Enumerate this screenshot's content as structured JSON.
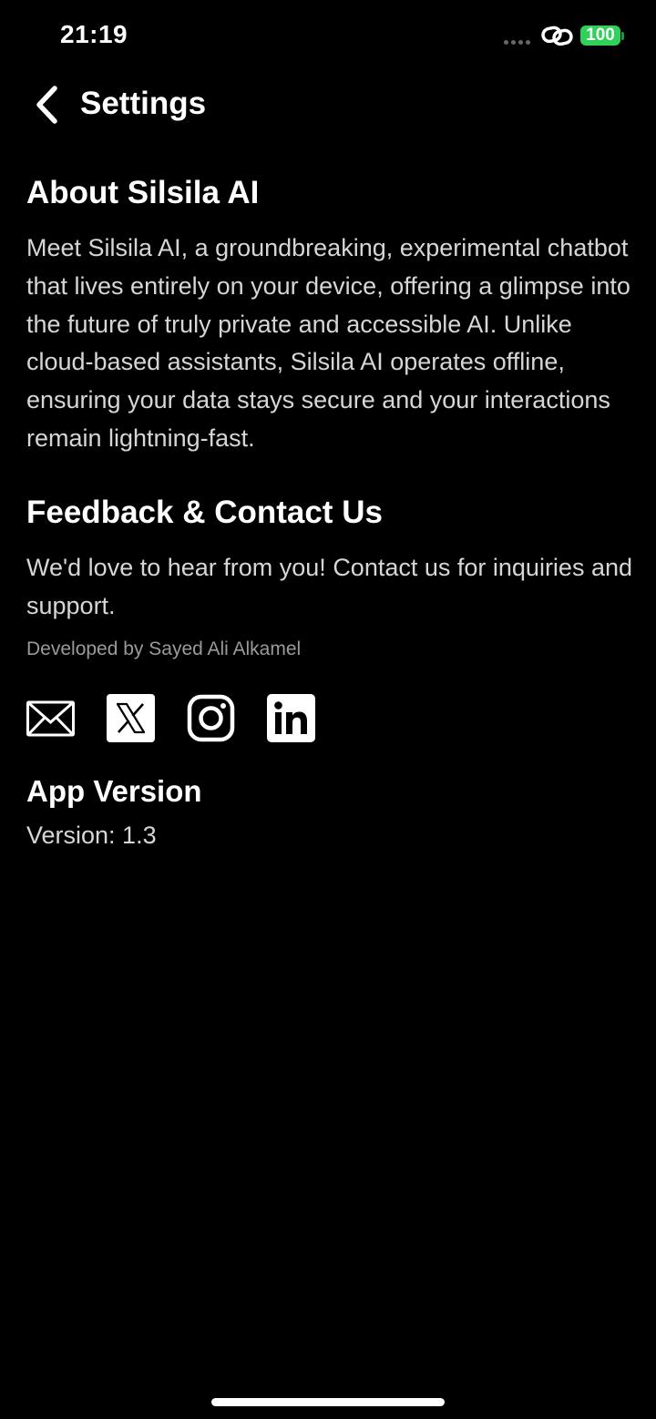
{
  "status_bar": {
    "time": "21:19",
    "battery_level": "100",
    "battery_color": "#30d158"
  },
  "header": {
    "title": "Settings",
    "back_icon": "chevron-left-icon"
  },
  "about": {
    "heading": "About Silsila AI",
    "body": "Meet Silsila AI, a groundbreaking, experimental chatbot that lives entirely on your device, offering a glimpse into the future of truly private and accessible AI. Unlike cloud-based assistants, Silsila AI operates offline, ensuring your data stays secure and your interactions remain lightning-fast."
  },
  "feedback": {
    "heading": "Feedback & Contact Us",
    "body": "We'd love to hear from you! Contact us for inquiries and support.",
    "developer": "Developed by Sayed Ali Alkamel",
    "social": [
      "mail-icon",
      "x-icon",
      "instagram-icon",
      "linkedin-icon"
    ]
  },
  "app_version": {
    "heading": "App Version",
    "version": "Version: 1.3"
  }
}
